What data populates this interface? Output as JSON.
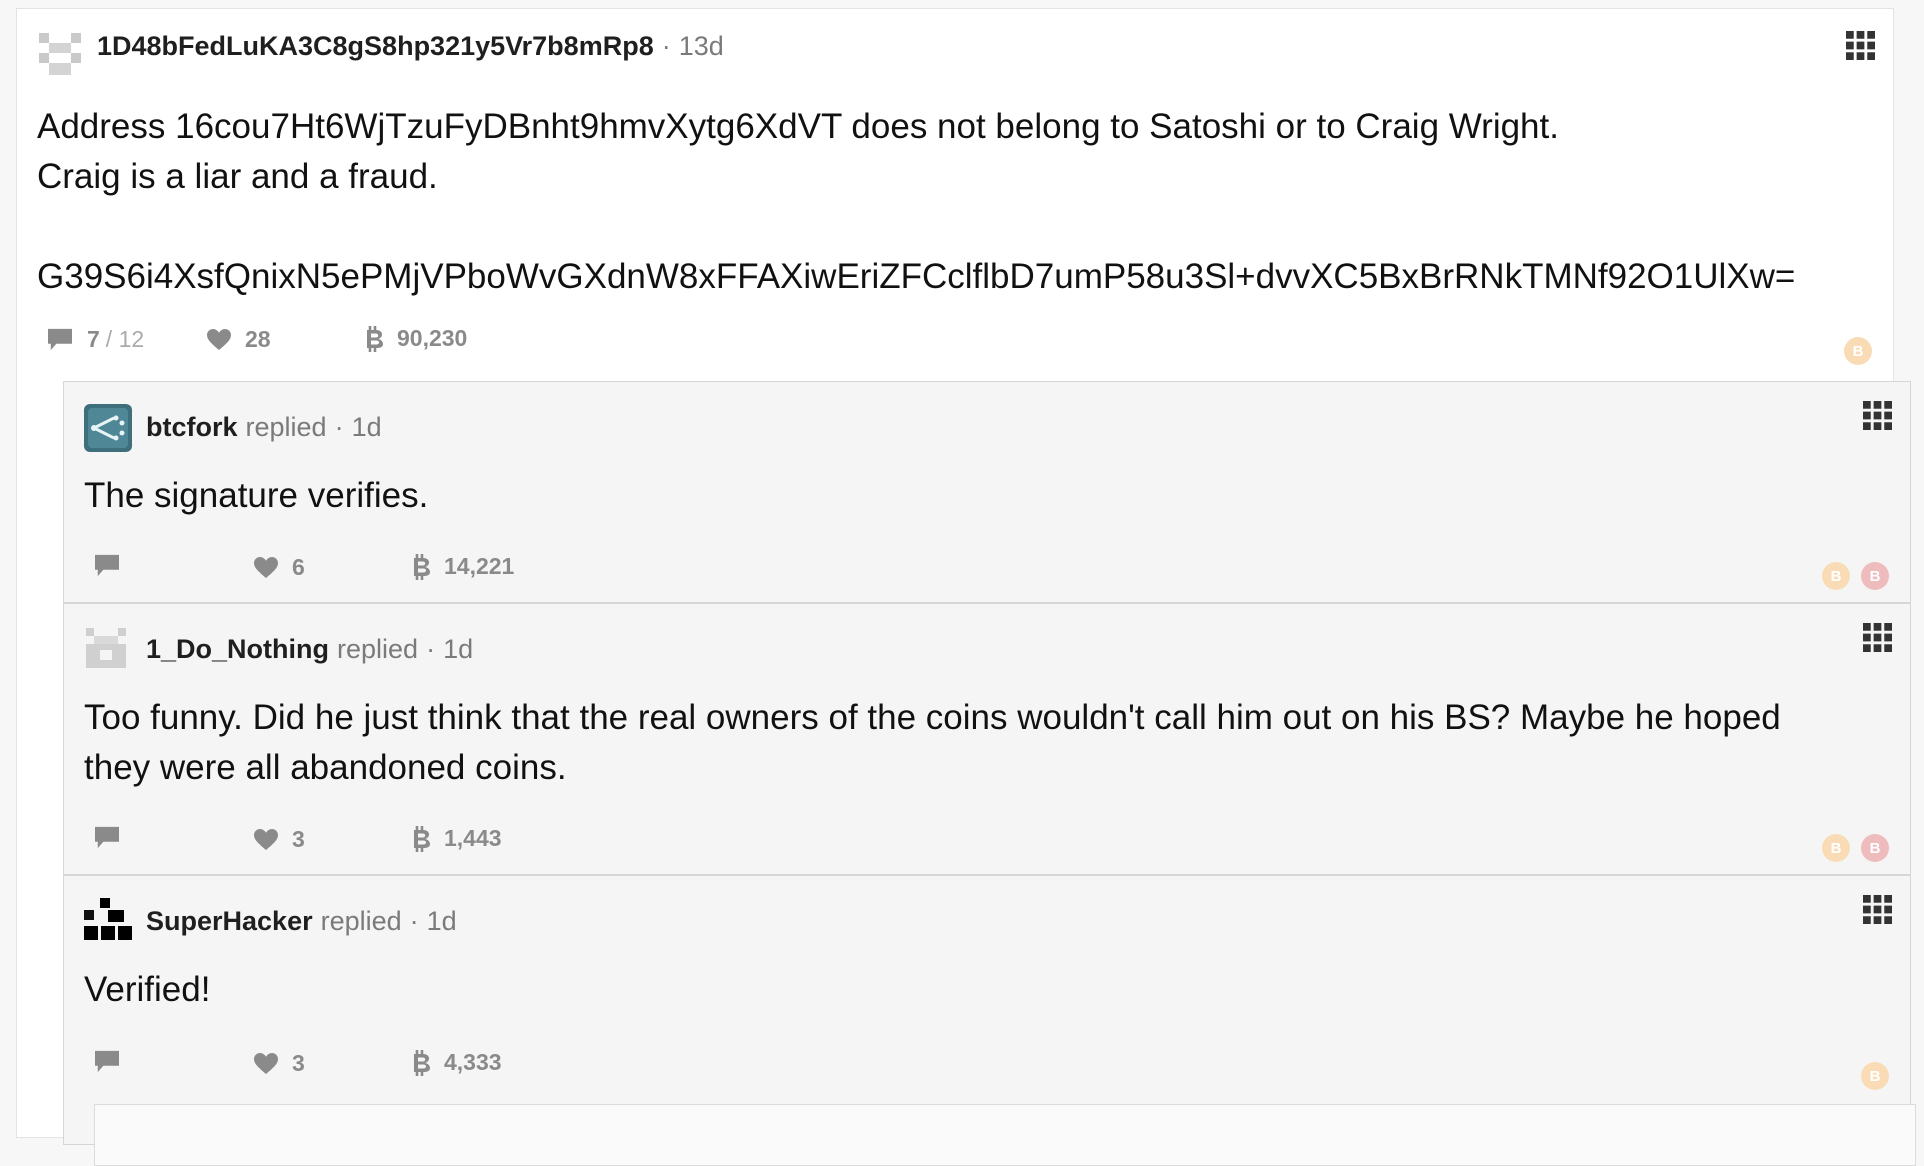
{
  "post": {
    "author": "1D48bFedLuKA3C8gS8hp321y5Vr7b8mRp8",
    "separator": "·",
    "age": "13d",
    "lines": [
      "Address 16cou7Ht6WjTzuFyDBnht9hmvXytg6XdVT does not belong to Satoshi or to Craig Wright.",
      "Craig is a liar and a fraud.",
      "G39S6i4XsfQnixN5ePMjVPboWvGXdnW8xFFAXiwEriZFCclflbD7umP58u3Sl+dvvXC5BxBrRNkTMNf92O1UlXw="
    ],
    "replies_shown": "7",
    "replies_total": "/ 12",
    "likes": "28",
    "tips": "90,230",
    "coin_glyph": "B"
  },
  "replies": [
    {
      "author": "btcfork",
      "action": "replied",
      "separator": "·",
      "age": "1d",
      "lines": [
        "The signature verifies."
      ],
      "likes": "6",
      "tips": "14,221"
    },
    {
      "author": "1_Do_Nothing",
      "action": "replied",
      "separator": "·",
      "age": "1d",
      "lines": [
        "Too funny. Did he just think that the real owners of the coins wouldn't call him out on his BS? Maybe he hoped",
        "they were all abandoned coins."
      ],
      "likes": "3",
      "tips": "1,443"
    },
    {
      "author": "SuperHacker",
      "action": "replied",
      "separator": "·",
      "age": "1d",
      "lines": [
        "Verified!"
      ],
      "likes": "3",
      "tips": "4,333"
    }
  ],
  "colors": {
    "coin_gold": "#f9dcb5",
    "coin_red": "#eebcbc",
    "icon_gray": "#8a8a8a"
  }
}
